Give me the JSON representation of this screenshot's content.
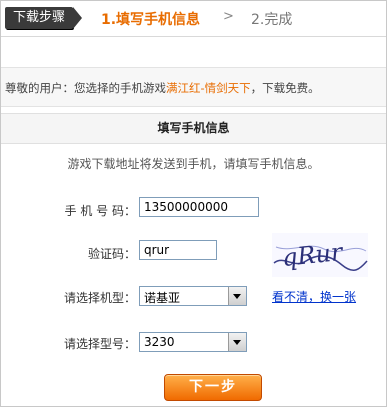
{
  "steps": {
    "tag": "下载步骤",
    "step1": "1.填写手机信息",
    "separator": ">",
    "step2": "2.完成"
  },
  "notice": {
    "prefix": "尊敬的用户：您选择的手机游戏",
    "game": "满江红-情剑天下",
    "suffix": "，下载免费。"
  },
  "panel": {
    "title": "填写手机信息",
    "tip": "游戏下载地址将发送到手机，请填写手机信息。"
  },
  "form": {
    "phone_label": "手 机 号 码：",
    "phone_value": "13500000000",
    "code_label": "验证码：",
    "code_value": "qrur",
    "brand_label": "请选择机型：",
    "brand_value": "诺基亚",
    "model_label": "请选择型号：",
    "model_value": "3230"
  },
  "captcha": {
    "image_text": "qRur",
    "refresh_link": "看不清，换一张"
  },
  "next_button": "下一步",
  "colors": {
    "accent": "#e86c00",
    "link": "#0033cc"
  }
}
